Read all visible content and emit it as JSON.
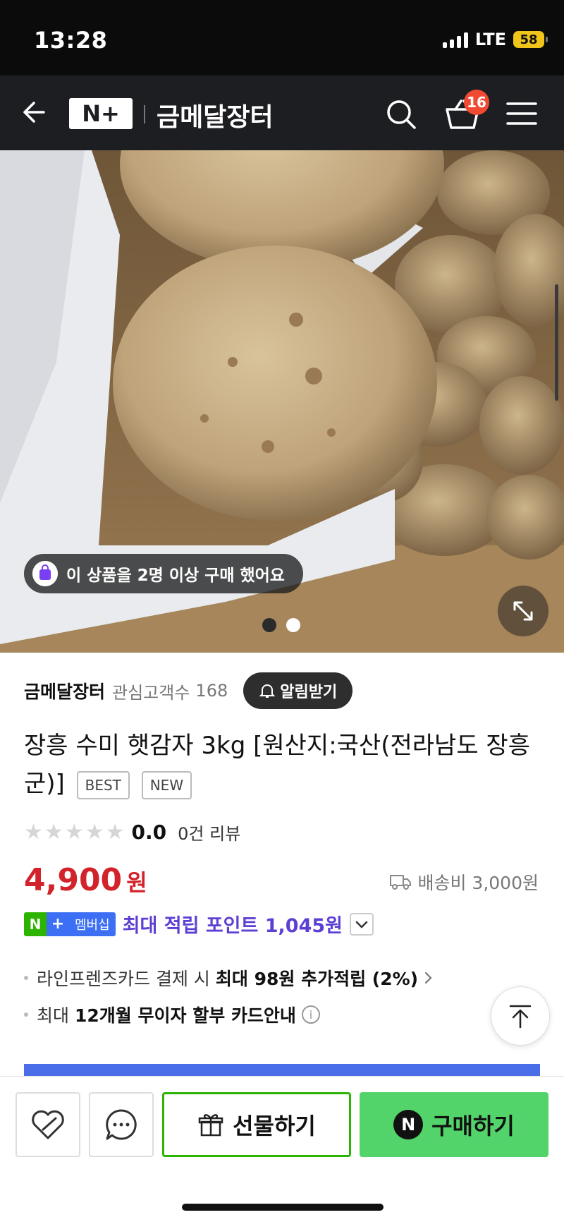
{
  "status_bar": {
    "time": "13:28",
    "network": "LTE",
    "battery": "58"
  },
  "header": {
    "logo": "N+",
    "store_title": "금메달장터",
    "cart_count": "16"
  },
  "hero": {
    "purchase_notice": "이 상품을 2명 이상 구매 했어요",
    "slide_count": 2,
    "active_slide": 1
  },
  "store": {
    "name": "금메달장터",
    "follower_label": "관심고객수",
    "follower_count": "168",
    "notify_label": "알림받기"
  },
  "product": {
    "title": "장흥 수미 햇감자 3kg [원산지:국산(전라남도 장흥군)]",
    "tags": [
      "BEST",
      "NEW"
    ],
    "rating": "0.0",
    "rating_stars": 0,
    "review_count": "0건 리뷰",
    "price": "4,900",
    "currency": "원",
    "shipping": "배송비 3,000원"
  },
  "membership": {
    "badge_n": "N",
    "badge_plus": "+",
    "badge_label": "멤버십",
    "text": "최대 적립 포인트 1,045원"
  },
  "benefits": [
    {
      "prefix": "라인프렌즈카드 결제 시",
      "bold": "최대 98원 추가적립 (2%)"
    },
    {
      "prefix": "최대",
      "bold": "12개월 무이자 할부 카드안내"
    }
  ],
  "actions": {
    "gift_label": "선물하기",
    "buy_label": "구매하기",
    "buy_icon": "N"
  },
  "colors": {
    "header_bg": "#1d1e22",
    "price": "#d2232a",
    "naver_green": "#2db400",
    "buy_bg": "#53d46a",
    "membership_text": "#5d3fd3"
  }
}
